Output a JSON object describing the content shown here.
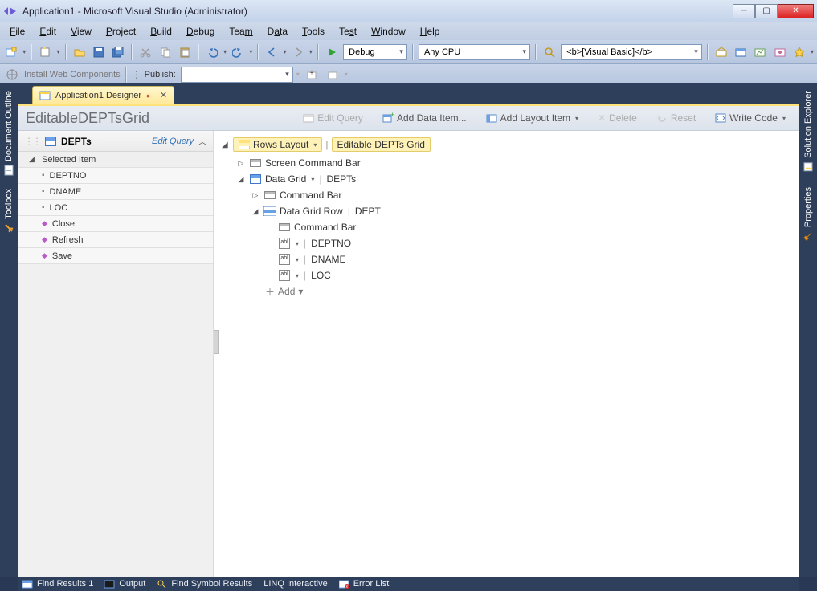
{
  "window": {
    "title": "Application1 - Microsoft Visual Studio (Administrator)"
  },
  "menu": {
    "items": [
      "File",
      "Edit",
      "View",
      "Project",
      "Build",
      "Debug",
      "Team",
      "Data",
      "Tools",
      "Test",
      "Window",
      "Help"
    ]
  },
  "toolbar1": {
    "config": "Debug",
    "platform": "Any CPU",
    "lang": "<b>[Visual Basic]</b>"
  },
  "toolbar2": {
    "install_web": "Install Web Components",
    "publish_label": "Publish:",
    "publish_value": ""
  },
  "doctab": {
    "title": "Application1 Designer"
  },
  "designer": {
    "title": "EditableDEPTsGrid",
    "buttons": {
      "edit_query": "Edit Query",
      "add_data_item": "Add Data Item...",
      "add_layout": "Add Layout Item",
      "delete": "Delete",
      "reset": "Reset",
      "write_code": "Write Code"
    }
  },
  "left_panel": {
    "header_name": "DEPTs",
    "edit_query": "Edit Query",
    "section": "Selected Item",
    "fields": [
      "DEPTNO",
      "DNAME",
      "LOC"
    ],
    "actions": [
      "Close",
      "Refresh",
      "Save"
    ]
  },
  "tree": {
    "root": {
      "label": "Rows Layout",
      "crumb": "Editable DEPTs Grid"
    },
    "screen_cmd": "Screen Command Bar",
    "data_grid": "Data Grid",
    "data_grid_entity": "DEPTs",
    "cmd_bar": "Command Bar",
    "data_grid_row": "Data Grid Row",
    "row_entity": "DEPT",
    "row_cmd": "Command Bar",
    "cols": [
      "DEPTNO",
      "DNAME",
      "LOC"
    ],
    "add": "Add"
  },
  "left_dock": {
    "tabs": [
      "Document Outline",
      "Toolbox"
    ]
  },
  "right_dock": {
    "tabs": [
      "Solution Explorer",
      "Properties"
    ]
  },
  "status": {
    "items": [
      "Find Results 1",
      "Output",
      "Find Symbol Results",
      "LINQ Interactive",
      "Error List"
    ]
  }
}
